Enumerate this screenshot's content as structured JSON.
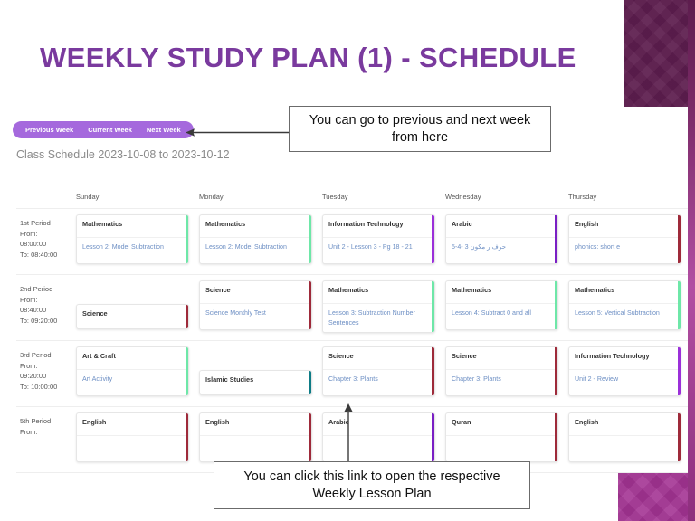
{
  "slide": {
    "title": "WEEKLY STUDY PLAN (1) - SCHEDULE",
    "title_color": "#7a3a9e",
    "deco_top_color": "#5d1d4e",
    "deco_bottom_color": "#a43494"
  },
  "week_nav": {
    "previous": "Previous Week",
    "current": "Current Week",
    "next": "Next Week",
    "pill_color": "#a569dd"
  },
  "schedule": {
    "caption": "Class Schedule 2023-10-08 to 2023-10-12",
    "day_headers": [
      "Sunday",
      "Monday",
      "Tuesday",
      "Wednesday",
      "Thursday"
    ],
    "rows": [
      {
        "period": "1st Period",
        "from_label": "From:",
        "from_time": "08:00:00",
        "to_time": "To: 08:40:00",
        "cells": [
          {
            "subject": "Mathematics",
            "lesson": "Lesson 2: Model Subtraction",
            "accent": "#6ee7a8",
            "tall": true
          },
          {
            "subject": "Mathematics",
            "lesson": "Lesson 2: Model Subtraction",
            "accent": "#6ee7a8",
            "tall": true
          },
          {
            "subject": "Information Technology",
            "lesson": "Unit 2 - Lesson 3 - Pg 18 - 21",
            "accent": "#9b30d9",
            "tall": true
          },
          {
            "subject": "Arabic",
            "lesson": "حرف ر مكون 3 -4-5",
            "accent": "#7a1fc4",
            "tall": true
          },
          {
            "subject": "English",
            "lesson": "phonics: short e",
            "accent": "#9e2a3a",
            "tall": true
          }
        ]
      },
      {
        "period": "2nd Period",
        "from_label": "From:",
        "from_time": "08:40:00",
        "to_time": "To: 09:20:00",
        "cells": [
          {
            "subject": "Science",
            "lesson": "",
            "accent": "#9e2a3a",
            "tall": false
          },
          {
            "subject": "Science",
            "lesson": "Science Monthly Test",
            "accent": "#9e2a3a",
            "tall": true
          },
          {
            "subject": "Mathematics",
            "lesson": "Lesson 3: Subtraction Number Sentences",
            "accent": "#6ee7a8",
            "tall": true
          },
          {
            "subject": "Mathematics",
            "lesson": "Lesson 4: Subtract 0 and all",
            "accent": "#6ee7a8",
            "tall": true
          },
          {
            "subject": "Mathematics",
            "lesson": "Lesson 5: Vertical Subtraction",
            "accent": "#6ee7a8",
            "tall": true
          }
        ]
      },
      {
        "period": "3rd Period",
        "from_label": "From:",
        "from_time": "09:20:00",
        "to_time": "To: 10:00:00",
        "cells": [
          {
            "subject": "Art & Craft",
            "lesson": "Art Activity",
            "accent": "#6ee7a8",
            "tall": true
          },
          {
            "subject": "Islamic Studies",
            "lesson": "",
            "accent": "#0e7c86",
            "tall": false
          },
          {
            "subject": "Science",
            "lesson": "Chapter 3: Plants",
            "accent": "#9e2a3a",
            "tall": true
          },
          {
            "subject": "Science",
            "lesson": "Chapter 3: Plants",
            "accent": "#9e2a3a",
            "tall": true
          },
          {
            "subject": "Information Technology",
            "lesson": "Unit 2 - Review",
            "accent": "#9b30d9",
            "tall": true
          }
        ]
      },
      {
        "period": "5th Period",
        "from_label": "From:",
        "from_time": "",
        "to_time": "",
        "cells": [
          {
            "subject": "English",
            "lesson": "",
            "accent": "#9e2a3a",
            "tall": true
          },
          {
            "subject": "English",
            "lesson": "",
            "accent": "#9e2a3a",
            "tall": true
          },
          {
            "subject": "Arabic",
            "lesson": "",
            "accent": "#7a1fc4",
            "tall": true
          },
          {
            "subject": "Quran",
            "lesson": "",
            "accent": "#9e2a3a",
            "tall": true
          },
          {
            "subject": "English",
            "lesson": "",
            "accent": "#9e2a3a",
            "tall": true
          }
        ]
      }
    ]
  },
  "annotations": {
    "top": "You can go to previous and next week from here",
    "bottom": "You can click this link to open the respective Weekly Lesson Plan"
  }
}
